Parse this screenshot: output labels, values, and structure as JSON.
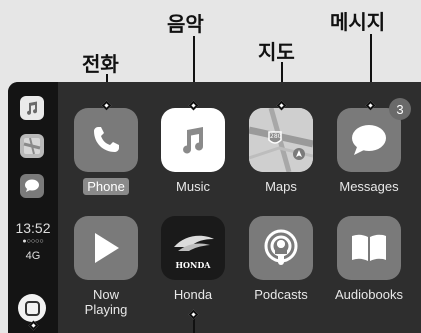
{
  "callouts": {
    "phone": "전화",
    "music": "음악",
    "maps": "지도",
    "messages": "메시지"
  },
  "sidebar": {
    "items": [
      {
        "icon": "music-note-icon"
      },
      {
        "icon": "maps-icon"
      },
      {
        "icon": "messages-icon"
      }
    ],
    "clock": "13:52",
    "signal_dots": "●○○○○",
    "network": "4G"
  },
  "apps": [
    {
      "label": "Phone",
      "icon": "phone-icon",
      "highlighted": true
    },
    {
      "label": "Music",
      "icon": "music-note-icon"
    },
    {
      "label": "Maps",
      "icon": "maps-icon",
      "map_shield": "280"
    },
    {
      "label": "Messages",
      "icon": "speech-bubble-icon",
      "badge": "3"
    },
    {
      "label": "Now Playing",
      "icon": "play-icon"
    },
    {
      "label": "Honda",
      "icon": "honda-wing-icon",
      "brand": "HONDA"
    },
    {
      "label": "Podcasts",
      "icon": "podcasts-icon"
    },
    {
      "label": "Audiobooks",
      "icon": "book-icon"
    }
  ],
  "colors": {
    "screen_bg": "#2e2e2e",
    "sidebar_bg": "#141414",
    "icon_gray": "#7a7a7a"
  }
}
